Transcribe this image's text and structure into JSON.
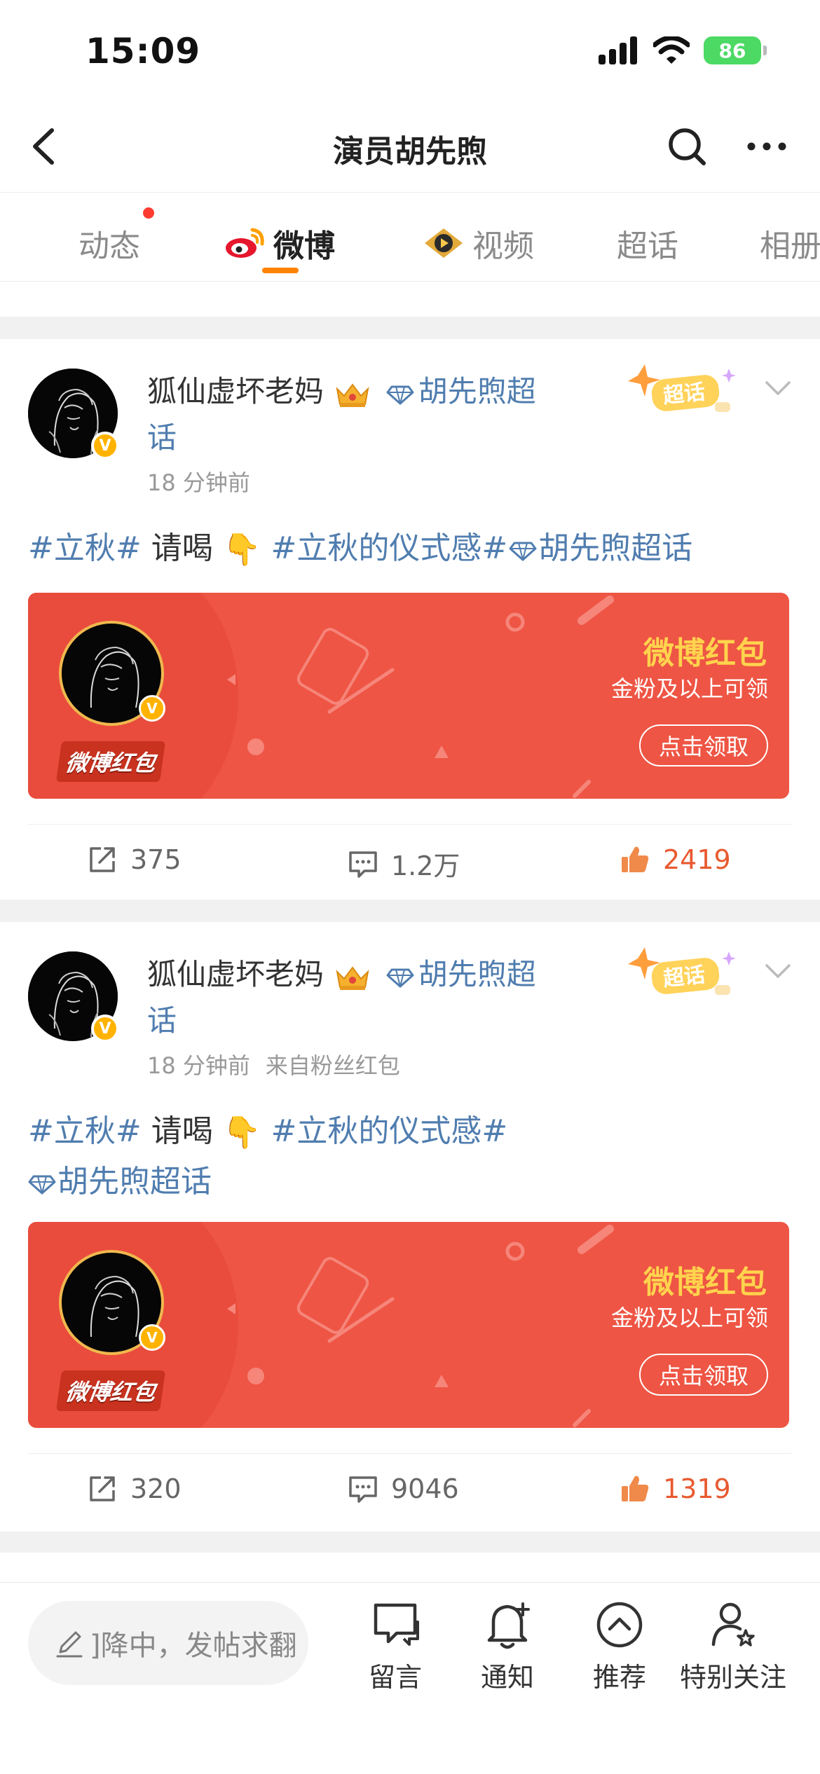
{
  "status_bar": {
    "time": "15:09",
    "battery": "86"
  },
  "nav": {
    "title": "演员胡先煦"
  },
  "tabs": [
    {
      "label": "动态"
    },
    {
      "label": "微博"
    },
    {
      "label": "视频"
    },
    {
      "label": "超话"
    },
    {
      "label": "相册"
    }
  ],
  "posts": [
    {
      "author": "狐仙虚坏老妈",
      "super_topic": "胡先煦超",
      "super_topic_wrap": "话",
      "time": "18 分钟前",
      "source": "",
      "badge": "超话",
      "text": {
        "tag1": "#立秋#",
        "word": " 请喝",
        "hand": "👇",
        "tag2": " #立秋的仪式感#",
        "tag3": "胡先煦超话"
      },
      "red_packet": {
        "brand": "微博红包",
        "title": "微博红包",
        "subtitle": "金粉及以上可领",
        "button": "点击领取"
      },
      "actions": {
        "repost": "375",
        "comment": "1.2万",
        "like": "2419"
      }
    },
    {
      "author": "狐仙虚坏老妈",
      "super_topic": "胡先煦超",
      "super_topic_wrap": "话",
      "time": "18 分钟前",
      "source": "来自粉丝红包",
      "badge": "超话",
      "text": {
        "tag1": "#立秋#",
        "word": " 请喝",
        "hand": "👇",
        "tag2": " #立秋的仪式感#",
        "tag3": "胡先煦超话"
      },
      "red_packet": {
        "brand": "微博红包",
        "title": "微博红包",
        "subtitle": "金粉及以上可领",
        "button": "点击领取"
      },
      "actions": {
        "repost": "320",
        "comment": "9046",
        "like": "1319"
      }
    }
  ],
  "bottom_bar": {
    "composer_placeholder": "]降中，发帖求翻",
    "items": [
      {
        "label": "留言",
        "icon": "message-icon"
      },
      {
        "label": "通知",
        "icon": "bell-plus-icon"
      },
      {
        "label": "推荐",
        "icon": "chevron-up-circle-icon"
      },
      {
        "label": "特别关注",
        "icon": "user-star-icon"
      }
    ]
  },
  "colors": {
    "accent": "#ff8200",
    "link": "#507daf",
    "like": "#e85a30",
    "red_packet": "#ee5544"
  }
}
